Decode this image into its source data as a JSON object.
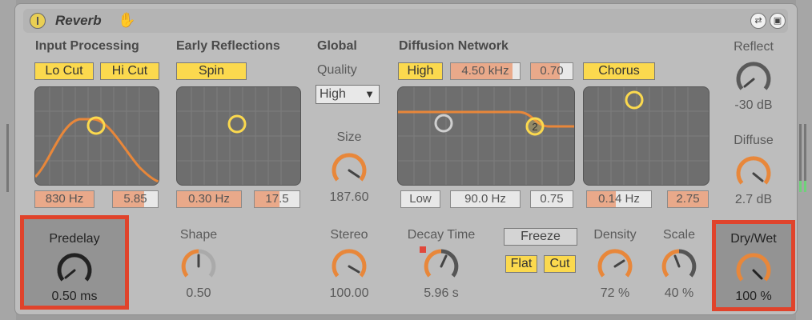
{
  "device": {
    "title": "Reverb"
  },
  "input_processing": {
    "title": "Input Processing",
    "lo_cut_label": "Lo Cut",
    "hi_cut_label": "Hi Cut",
    "freq": "830 Hz",
    "width": "5.85"
  },
  "early_reflections": {
    "title": "Early Reflections",
    "spin_label": "Spin",
    "amount": "0.30 Hz",
    "depth": "17.5"
  },
  "global": {
    "title": "Global",
    "quality_label": "Quality",
    "quality_value": "High",
    "size_label": "Size",
    "size_value": "187.60"
  },
  "diffusion": {
    "title": "Diffusion Network",
    "high_label": "High",
    "high_freq": "4.50 kHz",
    "high_amount": "0.70",
    "low_label": "Low",
    "low_freq": "90.0 Hz",
    "low_amount": "0.75",
    "chorus_label": "Chorus",
    "chorus_rate": "0.14 Hz",
    "chorus_amount": "2.75"
  },
  "reflect": {
    "label": "Reflect",
    "value": "-30 dB"
  },
  "diffuse": {
    "label": "Diffuse",
    "value": "2.7 dB"
  },
  "predelay": {
    "label": "Predelay",
    "value": "0.50 ms"
  },
  "shape": {
    "label": "Shape",
    "value": "0.50"
  },
  "stereo": {
    "label": "Stereo",
    "value": "100.00"
  },
  "decay": {
    "label": "Decay Time",
    "value": "5.96 s"
  },
  "freeze": {
    "label": "Freeze",
    "flat_label": "Flat",
    "cut_label": "Cut"
  },
  "density": {
    "label": "Density",
    "value": "72 %"
  },
  "scale": {
    "label": "Scale",
    "value": "40 %"
  },
  "drywet": {
    "label": "Dry/Wet",
    "value": "100 %"
  },
  "colors": {
    "accent_yellow": "#fbd94e",
    "knob_orange": "#e8873a",
    "highlight_red": "#e0432b",
    "graph_bg": "#6e6e6e"
  }
}
